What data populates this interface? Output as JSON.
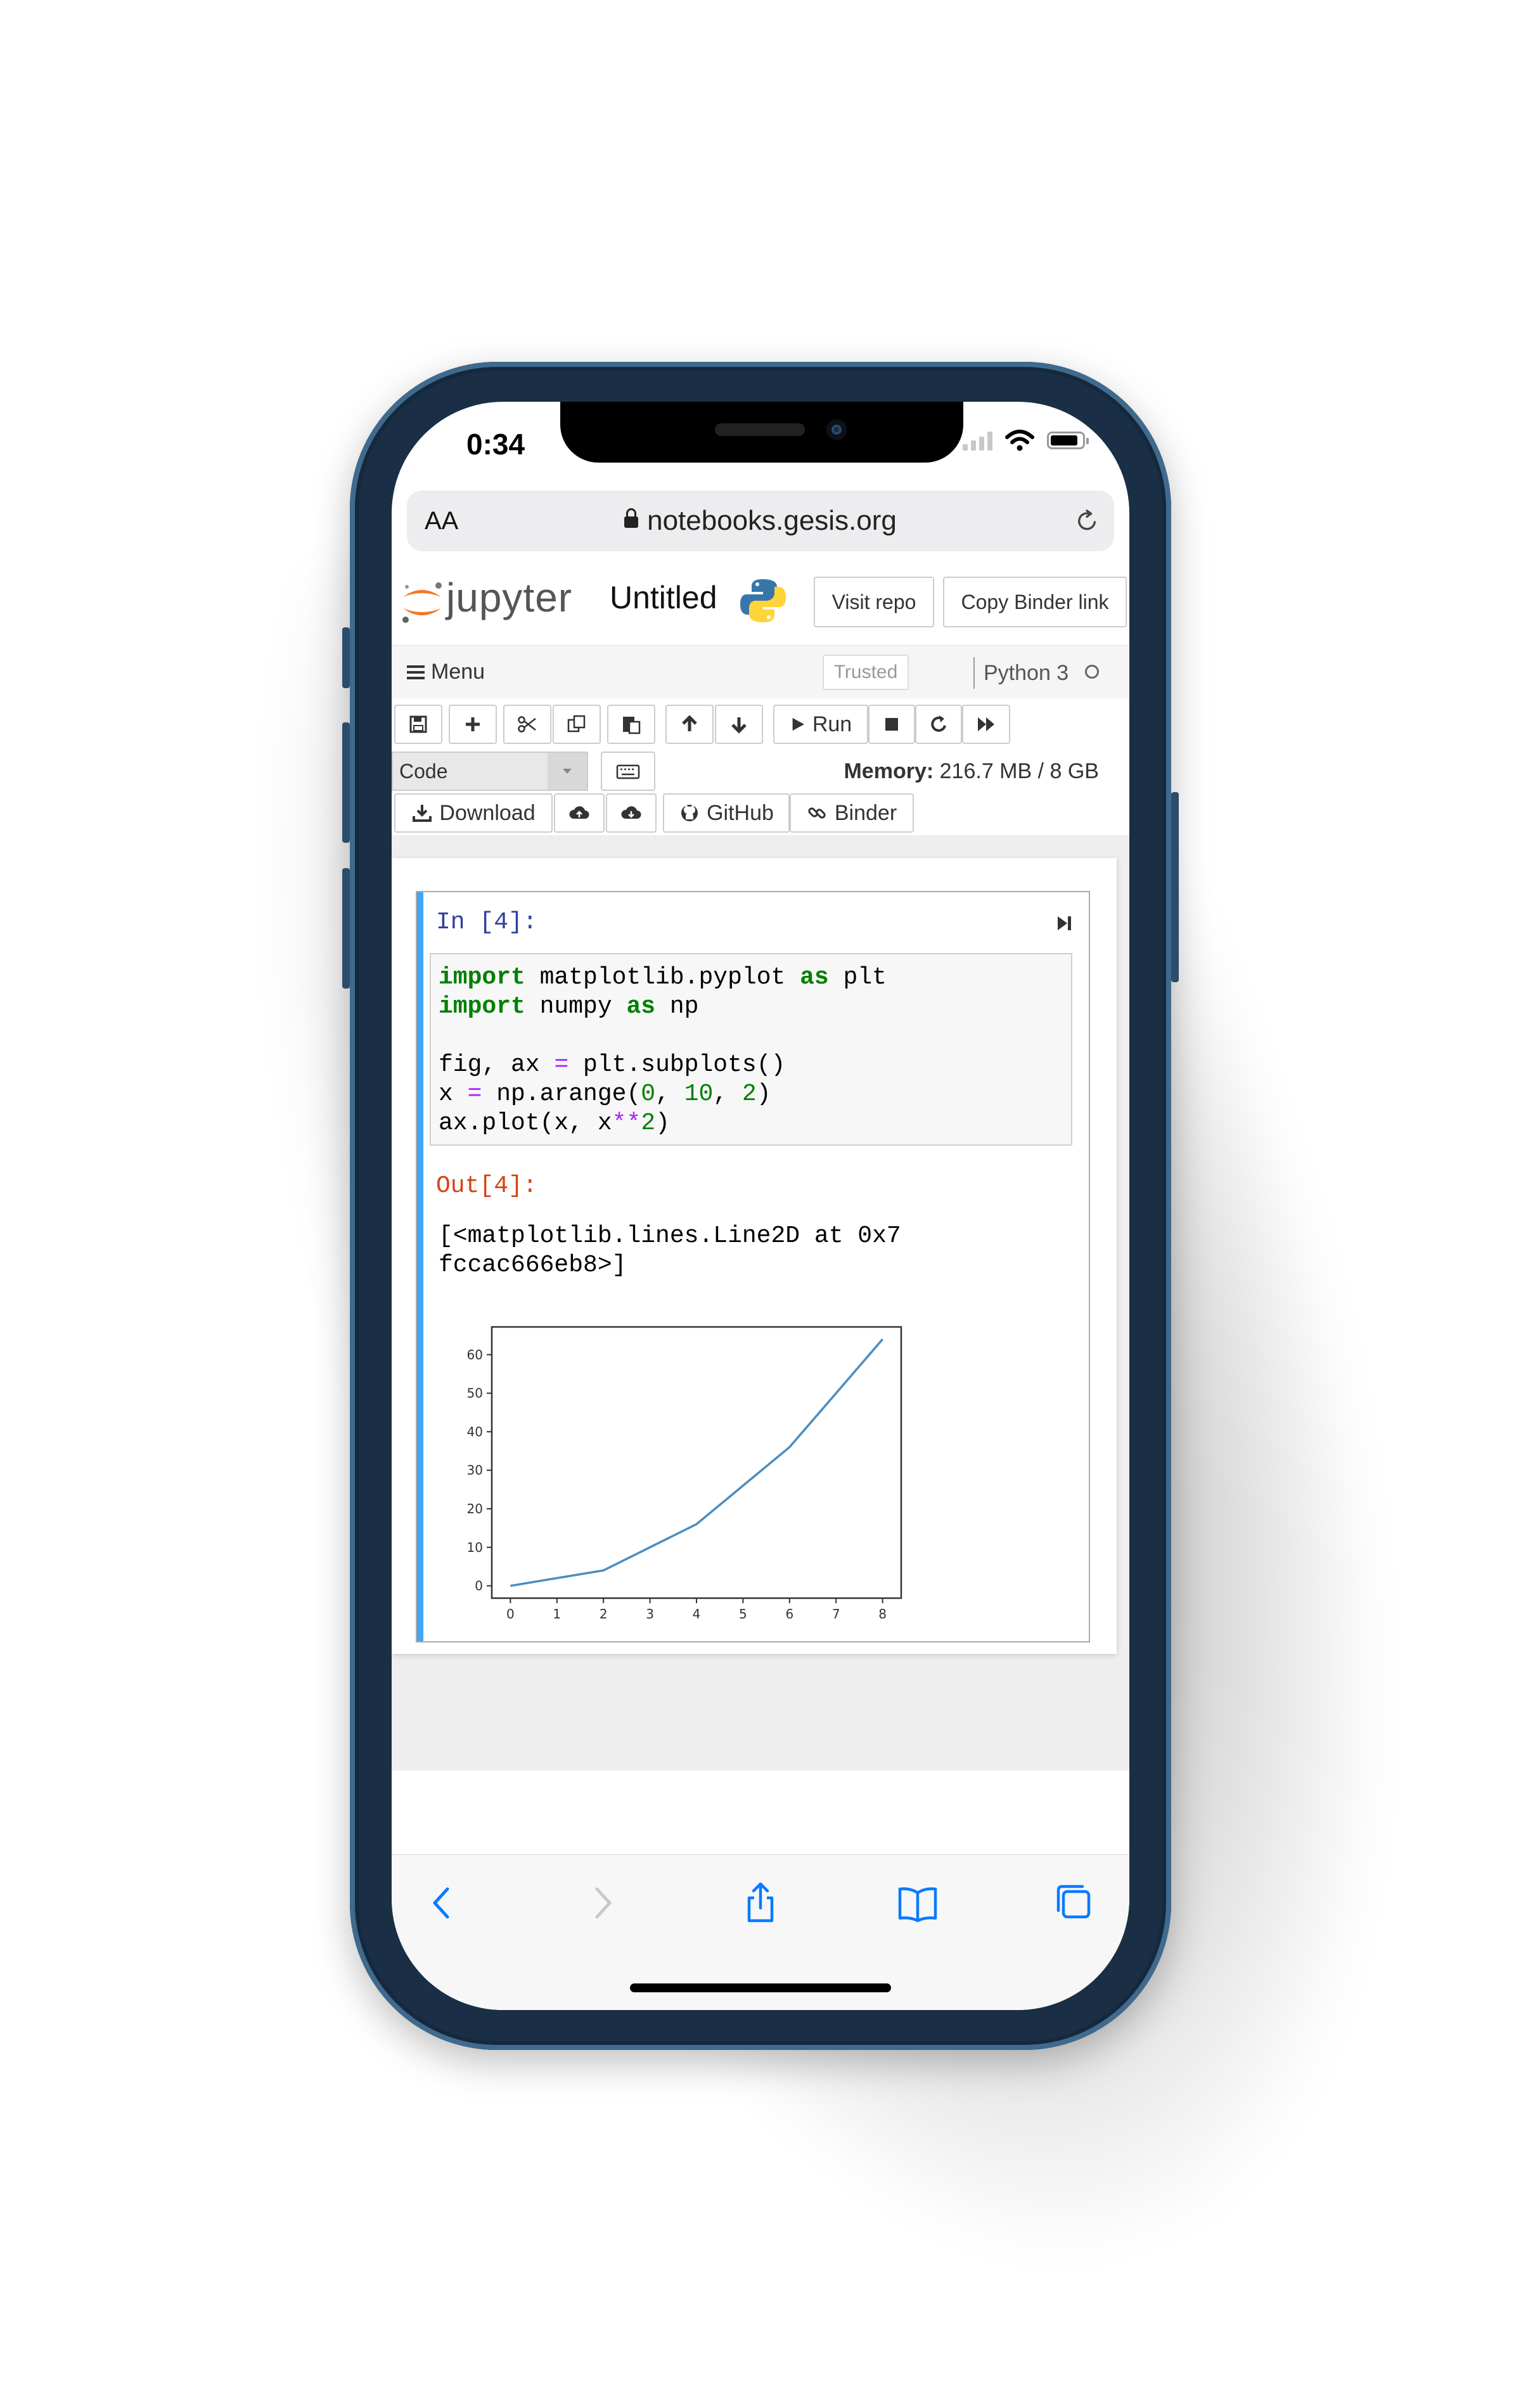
{
  "status": {
    "time": "0:34"
  },
  "browser": {
    "text_size_label": "AA",
    "url": "notebooks.gesis.org"
  },
  "jupyter": {
    "brand": "jupyter",
    "notebook_title": "Untitled",
    "visit_repo": "Visit repo",
    "copy_binder_link": "Copy Binder link",
    "menu": "Menu",
    "trusted": "Trusted",
    "kernel": "Python 3"
  },
  "toolbar": {
    "run": "Run",
    "cell_type": "Code",
    "memory_label": "Memory:",
    "memory_value": "216.7 MB / 8 GB",
    "download": "Download",
    "github": "GitHub",
    "binder": "Binder"
  },
  "cell": {
    "in_prompt": "In [4]:",
    "out_prompt": "Out[4]:",
    "output_lines": [
      "[<matplotlib.lines.Line2D at 0x7",
      "fccac666eb8>]"
    ]
  },
  "chart_data": {
    "type": "line",
    "x": [
      0,
      2,
      4,
      6,
      8
    ],
    "y": [
      0,
      4,
      16,
      36,
      64
    ],
    "xlim": [
      -0.4,
      8.4
    ],
    "ylim": [
      -3.2,
      67.2
    ],
    "xticks": [
      0,
      1,
      2,
      3,
      4,
      5,
      6,
      7,
      8
    ],
    "yticks": [
      0,
      10,
      20,
      30,
      40,
      50,
      60
    ],
    "line_color": "#4c8dbf",
    "grid": false
  }
}
